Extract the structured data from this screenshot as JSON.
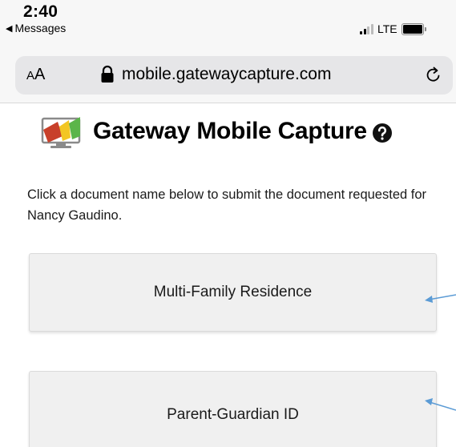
{
  "status_bar": {
    "time": "2:40",
    "back_app_label": "Messages",
    "network": "LTE"
  },
  "browser": {
    "text_size_label_small": "A",
    "text_size_label_large": "A",
    "url": "mobile.gatewaycapture.com"
  },
  "header": {
    "title": "Gateway Mobile Capture"
  },
  "main": {
    "instructions": "Click a document name below to submit the document requested for Nancy Gaudino.",
    "documents": [
      {
        "label": "Multi-Family Residence"
      },
      {
        "label": "Parent-Guardian ID"
      }
    ]
  },
  "colors": {
    "arrow": "#5b9bd5",
    "button_bg": "#f0f0f0",
    "url_bar_bg": "#e6e6e8",
    "logo_red": "#c8402a",
    "logo_yellow": "#f3c623",
    "logo_green": "#5bb54a"
  }
}
